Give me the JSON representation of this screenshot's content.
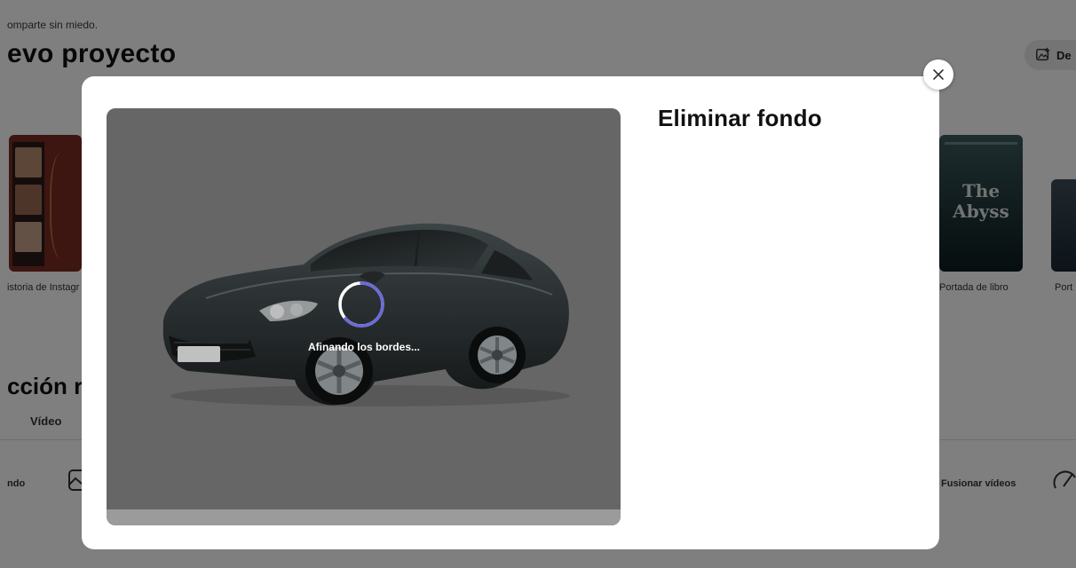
{
  "background": {
    "tagline": "omparte sin miedo.",
    "section_title": "evo proyecto",
    "top_button_label": "De",
    "cards": [
      {
        "label": "istoria de Instagr"
      },
      {
        "label": "Portada de libro",
        "cover_title": "The Abyss"
      },
      {
        "label": "Port"
      }
    ],
    "quick_actions_title": "cción rá",
    "tab_label": "Vídeo",
    "quick_actions": [
      {
        "label": "ndo"
      },
      {
        "label": "Fusionar vídeos"
      }
    ]
  },
  "modal": {
    "title": "Eliminar fondo",
    "progress_text": "Afinando los bordes...",
    "spinner_color": "#6b6bd8"
  }
}
